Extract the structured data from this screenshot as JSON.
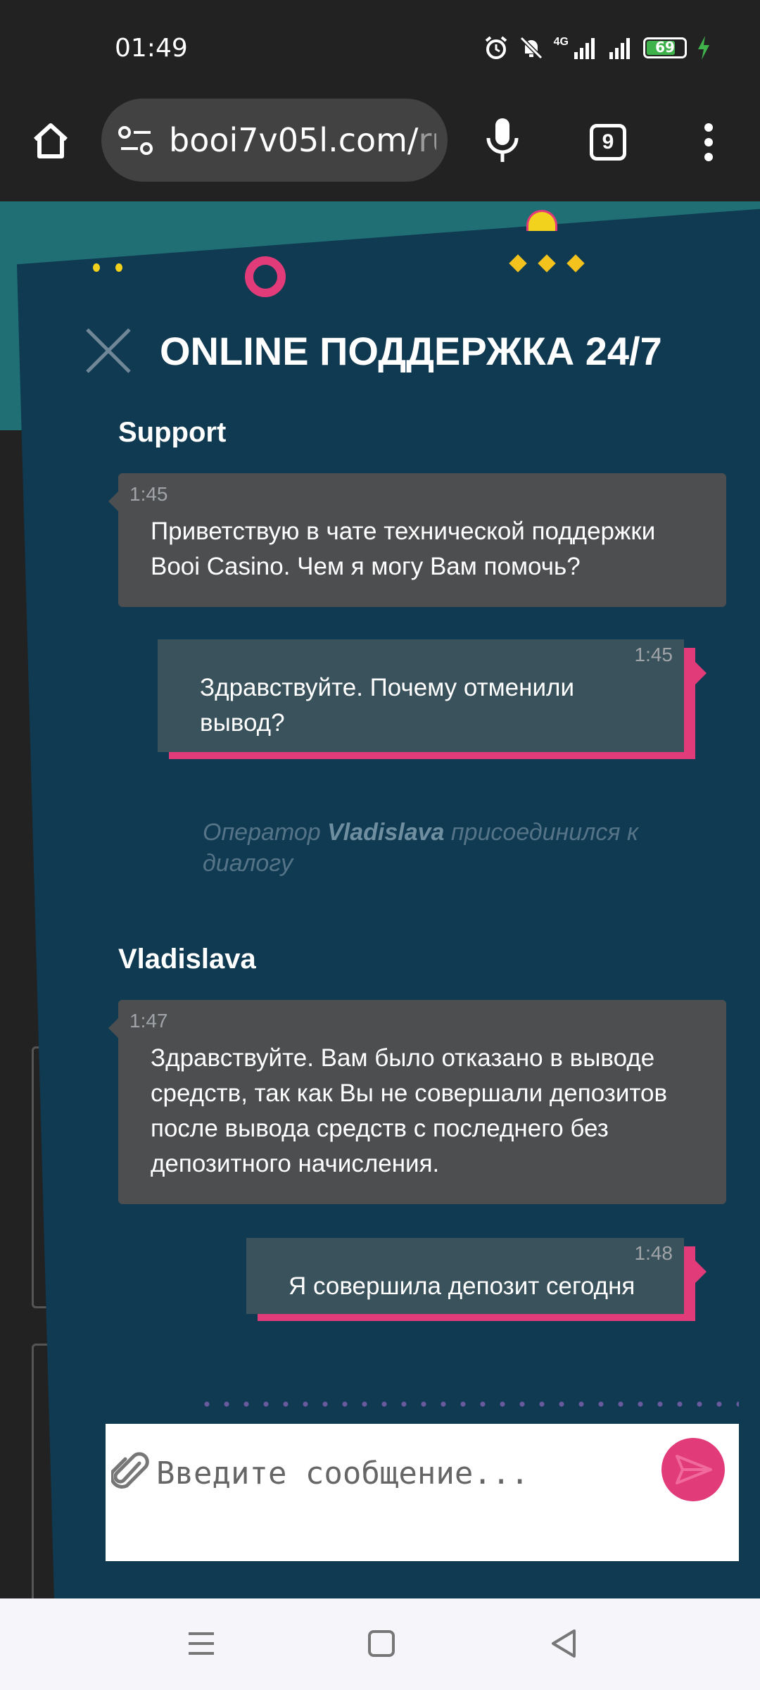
{
  "status_bar": {
    "time": "01:49",
    "network": "4G",
    "battery": "69"
  },
  "browser": {
    "url_main": "booi7v05l.com/",
    "url_dim": "ru",
    "tab_count": "9"
  },
  "chat": {
    "title": "ONLINE ПОДДЕРЖКА 24/7",
    "messages": [
      {
        "sender": "Support",
        "time": "1:45",
        "text": "Приветствую в чате технической поддержки Booi Casino. Чем я могу Вам помочь?"
      },
      {
        "time": "1:45",
        "text_line1": "Здравствуйте. Почему отменили",
        "text_line2": "вывод?"
      },
      {
        "system_prefix": "Оператор ",
        "system_name": "Vladislava",
        "system_suffix": " присоединился к диалогу"
      },
      {
        "sender": "Vladislava",
        "time": "1:47",
        "text": "Здравствуйте. Вам было отказано в выводе средств, так как Вы не совершали депозитов после вывода средств с последнего без депозитного начисления."
      },
      {
        "time": "1:48",
        "text": "Я совершила депозит сегодня"
      }
    ],
    "input_placeholder": "Введите сообщение..."
  },
  "colors": {
    "modal_bg": "#103a52",
    "accent_pink": "#e23b7a",
    "incoming_bubble": "#4d4e50",
    "outgoing_bubble": "#3a525b"
  },
  "icons": {
    "home": "home-icon",
    "site_settings": "site-settings-icon",
    "mic": "microphone-icon",
    "menu": "more-vertical-icon",
    "close": "close-icon",
    "attach": "paperclip-icon",
    "send": "send-icon"
  }
}
